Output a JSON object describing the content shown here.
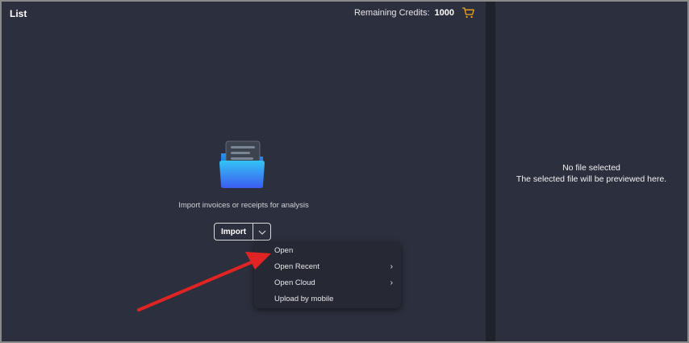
{
  "header": {
    "title": "List",
    "credits_label": "Remaining Credits:",
    "credits_value": "1000",
    "cart_icon": "shopping-cart-icon"
  },
  "import_area": {
    "icon": "folder-documents-icon",
    "caption": "Import invoices or receipts for analysis",
    "import_label": "Import",
    "dropdown_icon": "chevron-down-icon"
  },
  "import_menu": {
    "items": [
      {
        "label": "Open",
        "has_submenu": false
      },
      {
        "label": "Open Recent",
        "has_submenu": true
      },
      {
        "label": "Open Cloud",
        "has_submenu": true
      },
      {
        "label": "Upload by mobile",
        "has_submenu": false
      }
    ]
  },
  "preview": {
    "line1": "No file selected",
    "line2": "The selected file will be previewed here."
  },
  "colors": {
    "background": "#2c2f3d",
    "divider": "#1f212b",
    "menu_background": "#262833",
    "cart": "#f5a623",
    "folder_front": "#3b82f6",
    "annotation_arrow": "#e02424"
  }
}
